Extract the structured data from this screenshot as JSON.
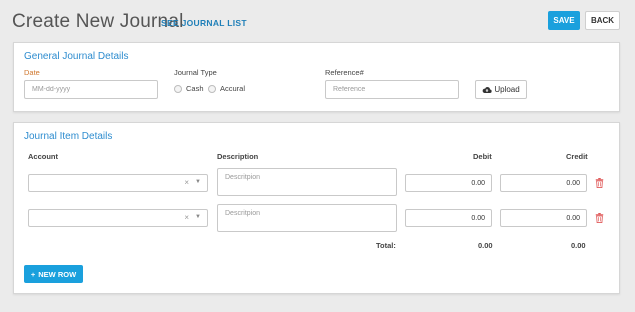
{
  "header": {
    "title": "Create New Journal",
    "see_list_label": "SEE JOURNAL LIST",
    "save_label": "SAVE",
    "back_label": "BACK"
  },
  "general": {
    "title": "General Journal Details",
    "date_label": "Date",
    "date_placeholder": "MM-dd-yyyy",
    "journal_type_label": "Journal Type",
    "journal_type_options": [
      "Cash",
      "Accural"
    ],
    "reference_label": "Reference#",
    "reference_placeholder": "Reference",
    "upload_label": "Upload"
  },
  "items": {
    "title": "Journal Item Details",
    "columns": {
      "account": "Account",
      "description": "Description",
      "debit": "Debit",
      "credit": "Credit"
    },
    "rows": [
      {
        "account": "",
        "description_placeholder": "Descritpion",
        "debit": "0.00",
        "credit": "0.00"
      },
      {
        "account": "",
        "description_placeholder": "Descritpion",
        "debit": "0.00",
        "credit": "0.00"
      }
    ],
    "total_label": "Total:",
    "total_debit": "0.00",
    "total_credit": "0.00",
    "new_row_label": "NEW ROW"
  },
  "colors": {
    "accent": "#1aa0dd",
    "panel_title": "#2d8ccf",
    "date_label": "#d0782f",
    "delete": "#e05a5a"
  },
  "icons": {
    "upload": "cloud-upload-icon",
    "delete": "trash-icon",
    "add": "plus-icon",
    "clear": "clear-icon",
    "caret": "chevron-down-icon"
  }
}
